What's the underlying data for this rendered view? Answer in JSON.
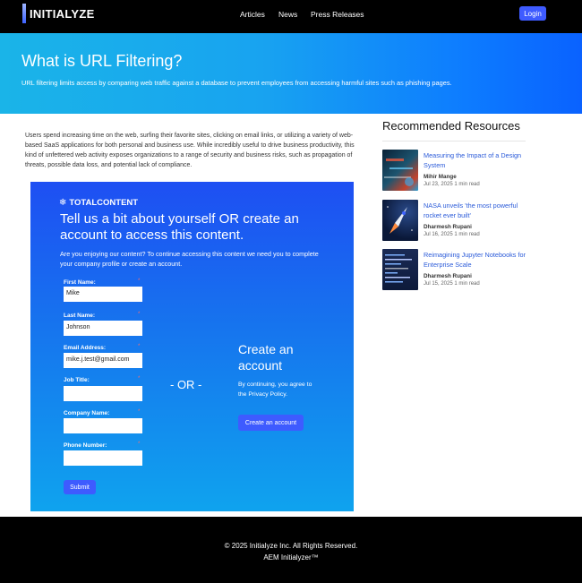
{
  "header": {
    "brand": "INITIALYZE",
    "nav": [
      "Articles",
      "News",
      "Press Releases"
    ],
    "login_label": "Login"
  },
  "hero": {
    "title": "What is URL Filtering?",
    "subtitle": "URL filtering limits access by comparing web traffic against a database to prevent employees from accessing harmful sites such as phishing pages."
  },
  "article": {
    "intro": "Users spend increasing time on the web, surfing their favorite sites, clicking on email links, or utilizing a variety of web-based SaaS applications for both personal and business use. While incredibly useful to drive business productivity, this kind of unfettered web activity exposes organizations to a range of security and business risks, such as propagation of threats, possible data loss, and potential lack of compliance."
  },
  "form": {
    "brand": "TOTALCONTENT",
    "title": "Tell us a bit about yourself OR create an account to access this content.",
    "description": "Are you enjoying our content? To continue accessing this content we need you to complete your company profile or create an account.",
    "fields": [
      {
        "label": "First Name:",
        "value": "Mike"
      },
      {
        "label": "Last Name:",
        "value": "Johnson"
      },
      {
        "label": "Email Address:",
        "value": "mike.j.test@gmail.com"
      },
      {
        "label": "Job Title:",
        "value": ""
      },
      {
        "label": "Company Name:",
        "value": ""
      },
      {
        "label": "Phone Number:",
        "value": ""
      }
    ],
    "required_mark": "*",
    "submit_label": "Submit",
    "or_label": "- OR -",
    "create_title": "Create an account",
    "create_desc": "By continuing, you agree to the Privacy Policy.",
    "create_button": "Create an account"
  },
  "sidebar": {
    "title": "Recommended Resources",
    "items": [
      {
        "title": "Measuring the Impact of a Design System",
        "author": "Mihir Mange",
        "meta": "Jul 23, 2025 1 min read"
      },
      {
        "title": "NASA unveils 'the most powerful rocket ever built'",
        "author": "Dharmesh Rupani",
        "meta": "Jul 16, 2025 1 min read"
      },
      {
        "title": "Reimagining Jupyter Notebooks for Enterprise Scale",
        "author": "Dharmesh Rupani",
        "meta": "Jul 15, 2025 1 min read"
      }
    ]
  },
  "footer": {
    "copyright": "© 2025 Initialyze Inc. All Rights Reserved.",
    "tagline": "AEM Initialyzer™"
  },
  "colors": {
    "primary_button": "#3e5bff",
    "link": "#2b5bd9",
    "hero_gradient": [
      "#1ab4e8",
      "#0a62ff"
    ]
  }
}
